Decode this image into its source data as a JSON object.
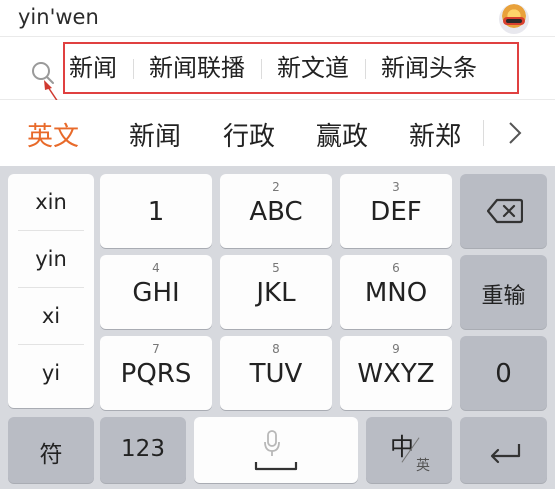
{
  "input": {
    "pinyin": "yin'wen"
  },
  "suggestions": [
    "新闻",
    "新闻联播",
    "新文道",
    "新闻头条"
  ],
  "candidates": [
    "英文",
    "新闻",
    "行政",
    "赢政",
    "新郑"
  ],
  "pinyin_options": [
    "xin",
    "yin",
    "xi",
    "yi"
  ],
  "keys": {
    "k1": {
      "label": "1"
    },
    "k2": {
      "num": "2",
      "label": "ABC"
    },
    "k3": {
      "num": "3",
      "label": "DEF"
    },
    "k4": {
      "num": "4",
      "label": "GHI"
    },
    "k5": {
      "num": "5",
      "label": "JKL"
    },
    "k6": {
      "num": "6",
      "label": "MNO"
    },
    "k7": {
      "num": "7",
      "label": "PQRS"
    },
    "k8": {
      "num": "8",
      "label": "TUV"
    },
    "k9": {
      "num": "9",
      "label": "WXYZ"
    },
    "k0": {
      "label": "0"
    },
    "reinput": "重输",
    "symbol": "符",
    "numbers": "123",
    "lang_main": "中",
    "lang_sub": "英"
  },
  "colors": {
    "accent": "#e86a2a",
    "highlight_box": "#e04040",
    "keyboard_bg": "#d7d9de"
  }
}
